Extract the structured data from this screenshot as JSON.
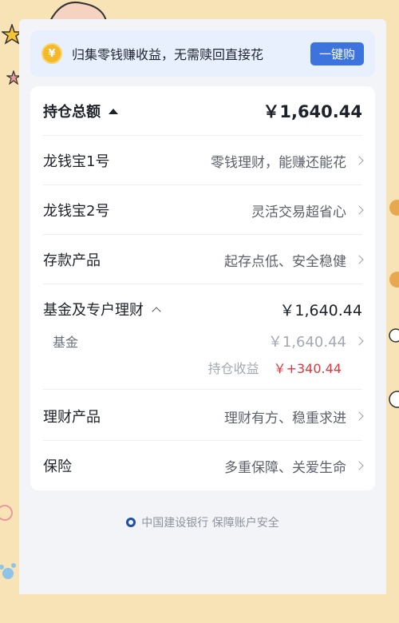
{
  "banner": {
    "coin_symbol": "¥",
    "text": "归集零钱赚收益，无需赎回直接花",
    "button": "一键购"
  },
  "total": {
    "label": "持仓总额",
    "amount": "￥1,640.44"
  },
  "products": [
    {
      "name": "龙钱宝1号",
      "desc": "零钱理财，能赚还能花"
    },
    {
      "name": "龙钱宝2号",
      "desc": "灵活交易超省心"
    },
    {
      "name": "存款产品",
      "desc": "起存点低、安全稳健"
    }
  ],
  "fund_section": {
    "name": "基金及专户理财",
    "amount": "￥1,640.44",
    "sub_name": "基金",
    "sub_amount": "￥1,640.44",
    "gain_label": "持仓收益",
    "gain_value": "￥+340.44"
  },
  "more_products": [
    {
      "name": "理财产品",
      "desc": "理财有方、稳重求进"
    },
    {
      "name": "保险",
      "desc": "多重保障、关爱生命"
    }
  ],
  "footer": {
    "text": "中国建设银行 保障账户安全"
  },
  "colors": {
    "accent": "#3c73dc",
    "gain": "#e0353b",
    "background": "#f7e3b6"
  }
}
